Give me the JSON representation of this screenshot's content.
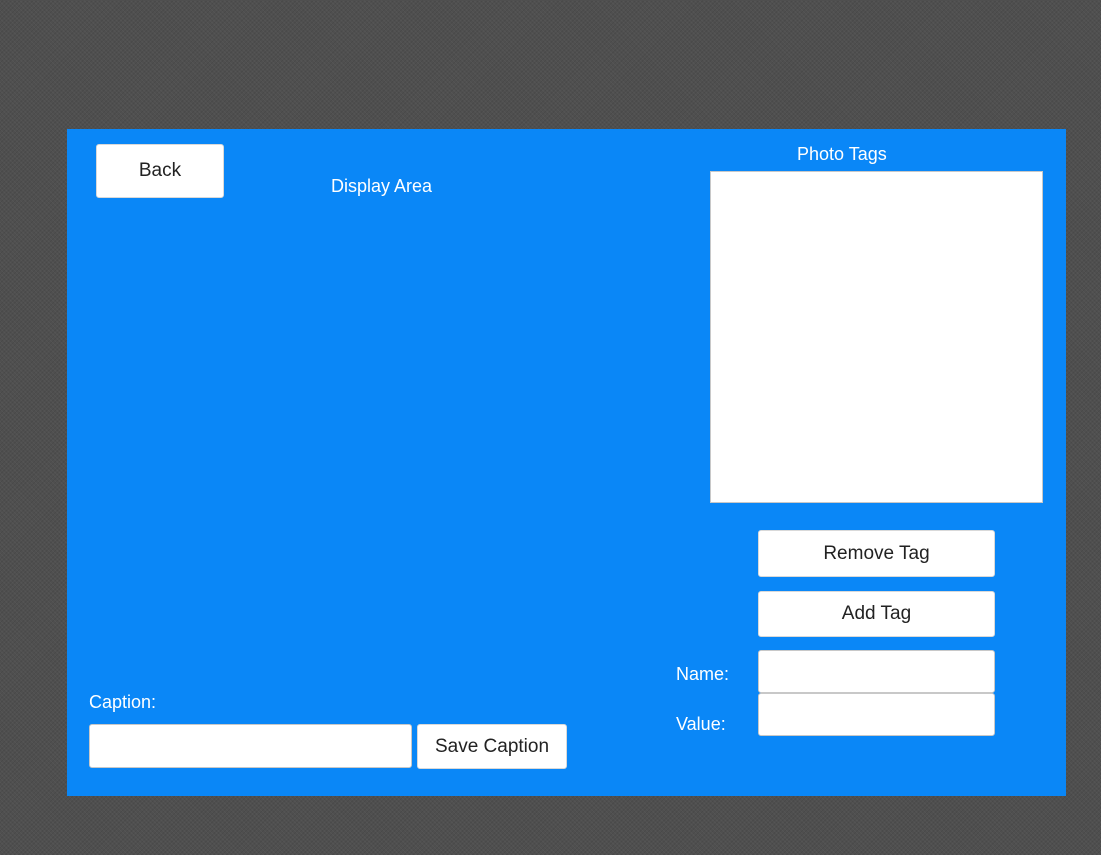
{
  "window": {
    "background_color": "#4f4f4f",
    "panel_color": "#0a87f7"
  },
  "nav": {
    "back_label": "Back"
  },
  "display": {
    "title": "Display Area"
  },
  "tags": {
    "title": "Photo Tags",
    "items": [],
    "remove_label": "Remove Tag",
    "add_label": "Add Tag",
    "name_label": "Name:",
    "value_label": "Value:",
    "name_value": "",
    "value_value": ""
  },
  "caption": {
    "label": "Caption:",
    "value": "",
    "save_label": "Save Caption"
  }
}
